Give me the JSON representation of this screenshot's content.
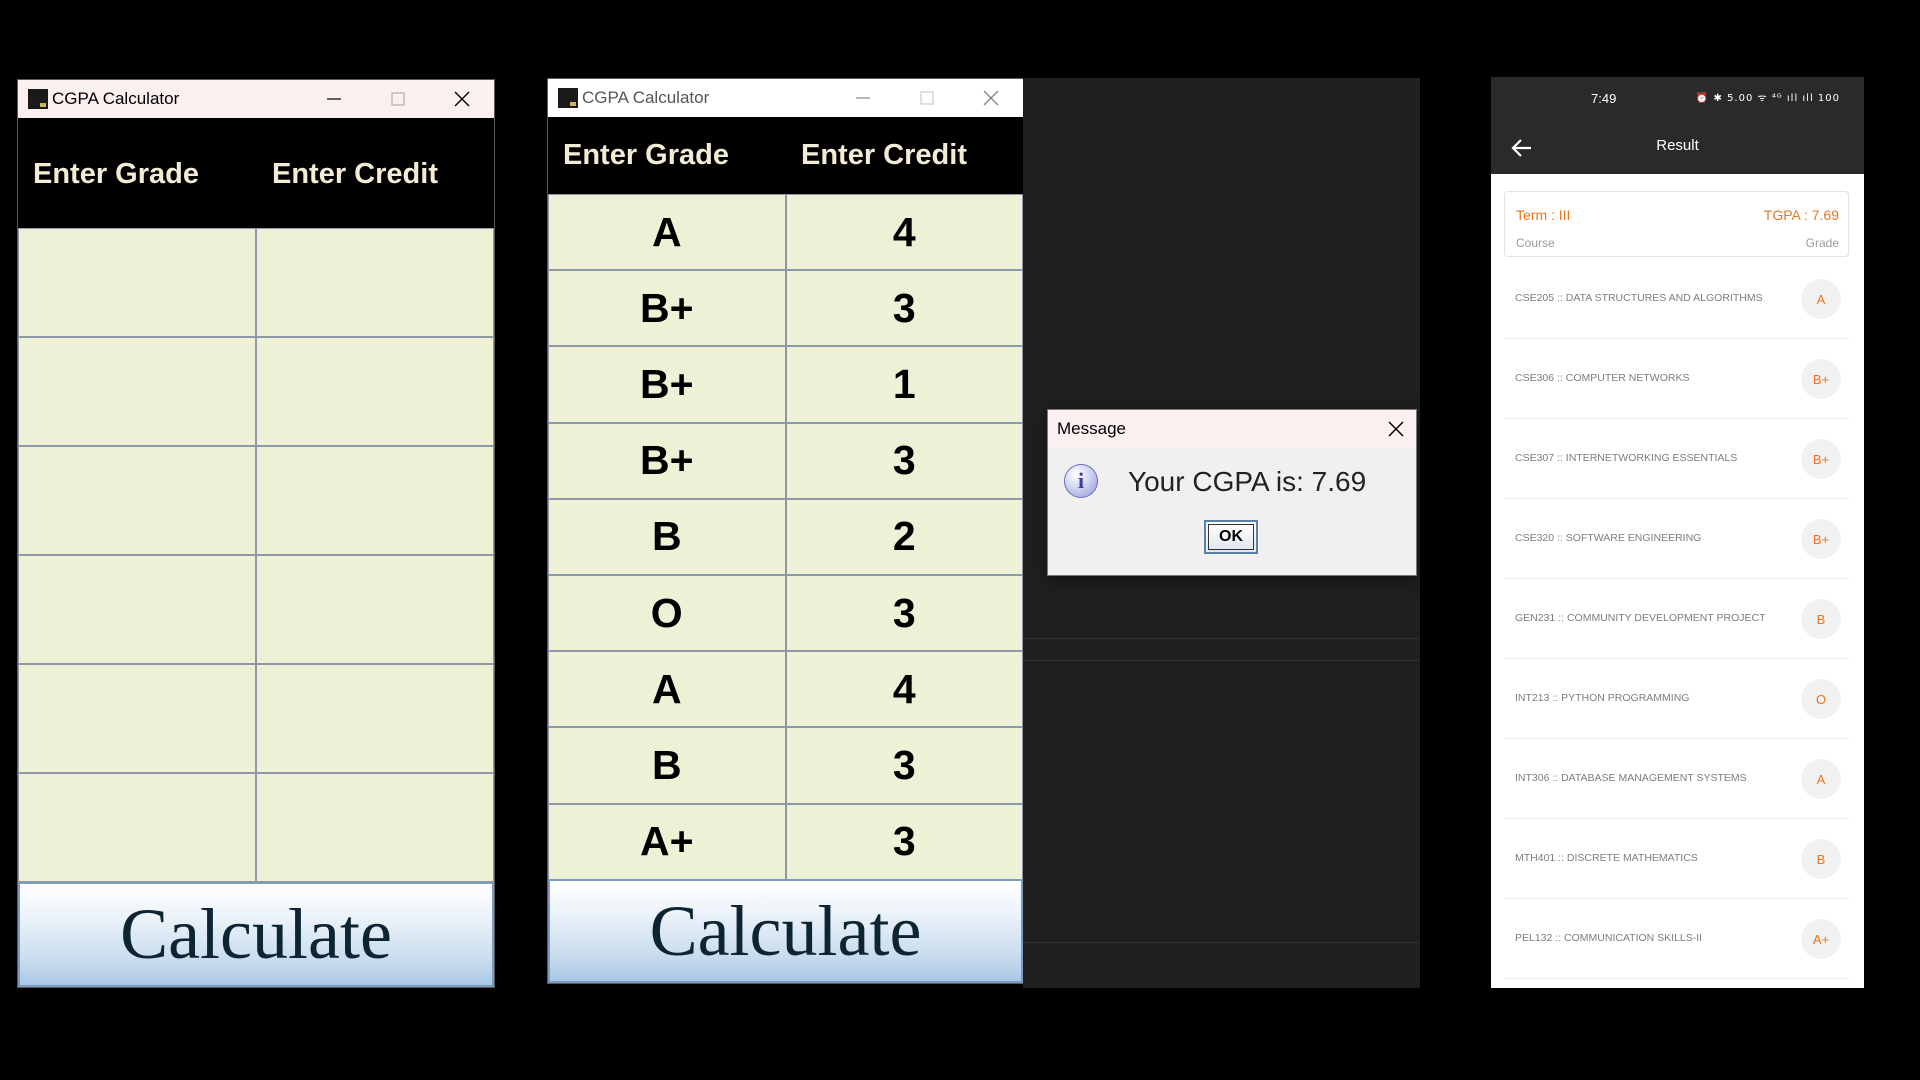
{
  "window1": {
    "title": "CGPA Calculator",
    "header_grade": "Enter Grade",
    "header_credit": "Enter Credit",
    "rows": [
      {
        "grade": "",
        "credit": ""
      },
      {
        "grade": "",
        "credit": ""
      },
      {
        "grade": "",
        "credit": ""
      },
      {
        "grade": "",
        "credit": ""
      },
      {
        "grade": "",
        "credit": ""
      },
      {
        "grade": "",
        "credit": ""
      }
    ],
    "button_label": "Calculate"
  },
  "window2": {
    "title": "CGPA Calculator",
    "header_grade": "Enter Grade",
    "header_credit": "Enter Credit",
    "rows": [
      {
        "grade": "A",
        "credit": "4"
      },
      {
        "grade": "B+",
        "credit": "3"
      },
      {
        "grade": "B+",
        "credit": "1"
      },
      {
        "grade": "B+",
        "credit": "3"
      },
      {
        "grade": "B",
        "credit": "2"
      },
      {
        "grade": "O",
        "credit": "3"
      },
      {
        "grade": "A",
        "credit": "4"
      },
      {
        "grade": "B",
        "credit": "3"
      },
      {
        "grade": "A+",
        "credit": "3"
      }
    ],
    "button_label": "Calculate"
  },
  "dialog": {
    "title": "Message",
    "icon": "info-icon",
    "message": "Your CGPA is: 7.69",
    "ok_label": "OK"
  },
  "phone": {
    "status_time": "7:49",
    "status_icons": "⏰ ✱ 5.00 ᯤ ⁴ᴳ ıll ıll 100",
    "title": "Result",
    "term": "Term : III",
    "tgpa": "TGPA : 7.69",
    "col_course": "Course",
    "col_grade": "Grade",
    "courses": [
      {
        "name": "CSE205 :: DATA STRUCTURES AND ALGORITHMS",
        "grade": "A"
      },
      {
        "name": "CSE306 :: COMPUTER NETWORKS",
        "grade": "B+"
      },
      {
        "name": "CSE307 :: INTERNETWORKING ESSENTIALS",
        "grade": "B+"
      },
      {
        "name": "CSE320 :: SOFTWARE ENGINEERING",
        "grade": "B+"
      },
      {
        "name": "GEN231 :: COMMUNITY DEVELOPMENT PROJECT",
        "grade": "B"
      },
      {
        "name": "INT213 :: PYTHON PROGRAMMING",
        "grade": "O"
      },
      {
        "name": "INT306 :: DATABASE MANAGEMENT SYSTEMS",
        "grade": "A"
      },
      {
        "name": "MTH401 :: DISCRETE MATHEMATICS",
        "grade": "B"
      },
      {
        "name": "PEL132 :: COMMUNICATION SKILLS-II",
        "grade": "A+"
      }
    ]
  },
  "colors": {
    "accent_orange": "#e8761e",
    "cell_bg": "#eef1d6",
    "header_text": "#f2ecd4"
  }
}
